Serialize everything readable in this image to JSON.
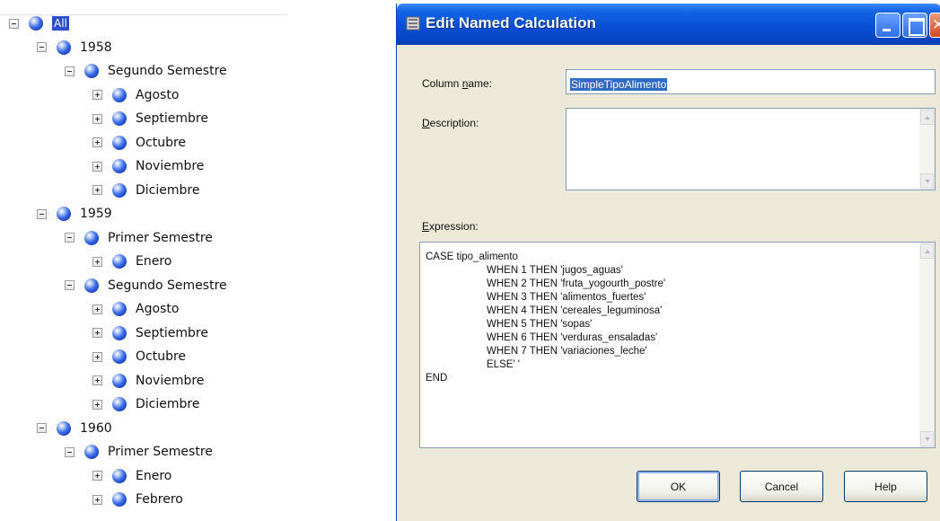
{
  "tree": {
    "nodes": [
      {
        "label": "All",
        "expander": "minus",
        "selected": true
      },
      {
        "label": "1958",
        "expander": "minus"
      },
      {
        "label": "Segundo Semestre",
        "expander": "minus"
      },
      {
        "label": "Agosto",
        "expander": "plus"
      },
      {
        "label": "Septiembre",
        "expander": "plus"
      },
      {
        "label": "Octubre",
        "expander": "plus"
      },
      {
        "label": "Noviembre",
        "expander": "plus"
      },
      {
        "label": "Diciembre",
        "expander": "plus"
      },
      {
        "label": "1959",
        "expander": "minus"
      },
      {
        "label": "Primer Semestre",
        "expander": "minus"
      },
      {
        "label": "Enero",
        "expander": "plus"
      },
      {
        "label": "Segundo Semestre",
        "expander": "minus"
      },
      {
        "label": "Agosto",
        "expander": "plus"
      },
      {
        "label": "Septiembre",
        "expander": "plus"
      },
      {
        "label": "Octubre",
        "expander": "plus"
      },
      {
        "label": "Noviembre",
        "expander": "plus"
      },
      {
        "label": "Diciembre",
        "expander": "plus"
      },
      {
        "label": "1960",
        "expander": "minus"
      },
      {
        "label": "Primer Semestre",
        "expander": "minus"
      },
      {
        "label": "Enero",
        "expander": "plus"
      },
      {
        "label": "Febrero",
        "expander": "plus"
      }
    ]
  },
  "dialog": {
    "title": "Edit Named Calculation",
    "column_name_label": {
      "pre": "Column ",
      "key": "n",
      "post": "ame:"
    },
    "column_name_value": "SimpleTipoAlimento",
    "description_label": {
      "pre": "",
      "key": "D",
      "post": "escription:"
    },
    "description_value": "",
    "expression_label": {
      "pre": "",
      "key": "E",
      "post": "xpression:"
    },
    "expression_lines": [
      {
        "text": "CASE tipo_alimento",
        "indent": false
      },
      {
        "text": "WHEN 1 THEN 'jugos_aguas'",
        "indent": true
      },
      {
        "text": "WHEN 2 THEN 'fruta_yogourth_postre'",
        "indent": true
      },
      {
        "text": "WHEN 3 THEN 'alimentos_fuertes'",
        "indent": true
      },
      {
        "text": "WHEN 4 THEN 'cereales_leguminosa'",
        "indent": true
      },
      {
        "text": "WHEN 5 THEN 'sopas'",
        "indent": true
      },
      {
        "text": "WHEN 6 THEN 'verduras_ensaladas'",
        "indent": true
      },
      {
        "text": "WHEN 7 THEN 'variaciones_leche'",
        "indent": true
      },
      {
        "text": "ELSE' '",
        "indent": true
      },
      {
        "text": "END",
        "indent": false
      }
    ],
    "buttons": {
      "ok": "OK",
      "cancel": "Cancel",
      "help": "Help"
    }
  },
  "colors": {
    "title_bar": "#0a4fd6",
    "dialog_bg": "#ece9d8",
    "selection": "#316ac5"
  }
}
